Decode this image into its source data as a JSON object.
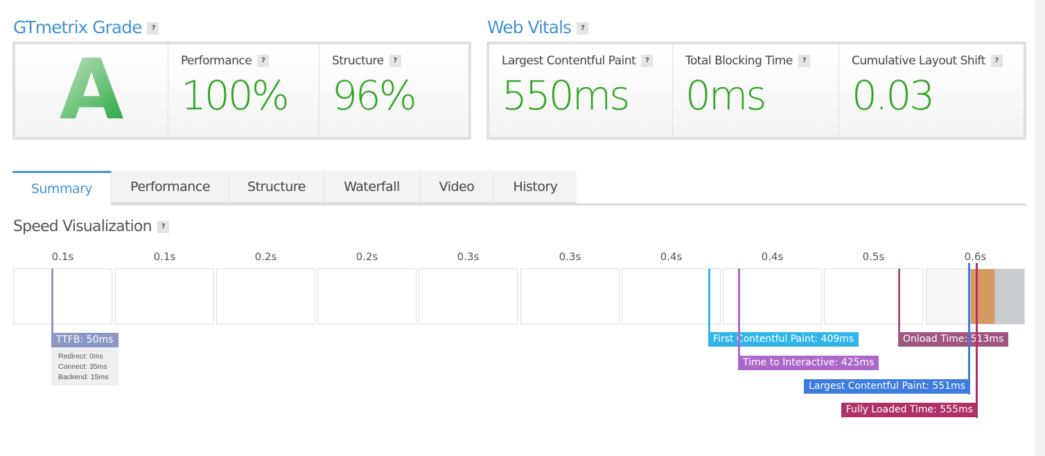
{
  "grade": {
    "title": "GTmetrix Grade",
    "help": "?",
    "letter": "A",
    "metrics": [
      {
        "label": "Performance",
        "value": "100%"
      },
      {
        "label": "Structure",
        "value": "96%"
      }
    ]
  },
  "vitals": {
    "title": "Web Vitals",
    "help": "?",
    "metrics": [
      {
        "label": "Largest Contentful Paint",
        "value": "550ms"
      },
      {
        "label": "Total Blocking Time",
        "value": "0ms"
      },
      {
        "label": "Cumulative Layout Shift",
        "value": "0.03"
      }
    ]
  },
  "tabs": [
    {
      "label": "Summary",
      "active": true
    },
    {
      "label": "Performance"
    },
    {
      "label": "Structure"
    },
    {
      "label": "Waterfall"
    },
    {
      "label": "Video"
    },
    {
      "label": "History"
    }
  ],
  "speed": {
    "title": "Speed Visualization",
    "help": "?",
    "ticks": [
      "0.1s",
      "0.1s",
      "0.2s",
      "0.2s",
      "0.3s",
      "0.3s",
      "0.4s",
      "0.4s",
      "0.5s",
      "0.6s"
    ],
    "ttfb": {
      "label": "TTFB: 50ms",
      "details": [
        "Redirect: 0ms",
        "Connect: 35ms",
        "Backend: 15ms"
      ],
      "color": "#8b97c4"
    },
    "markers": [
      {
        "label": "First Contentful Paint: 409ms",
        "color": "#2fb5e8"
      },
      {
        "label": "Time to Interactive: 425ms",
        "color": "#ad67c9"
      },
      {
        "label": "Onload Time: 513ms",
        "color": "#a0577f"
      },
      {
        "label": "Largest Contentful Paint: 551ms",
        "color": "#3f7ce0"
      },
      {
        "label": "Fully Loaded Time: 555ms",
        "color": "#b03068"
      }
    ]
  },
  "colors": {
    "accent": "#4393d2",
    "good": "#2ea621"
  }
}
